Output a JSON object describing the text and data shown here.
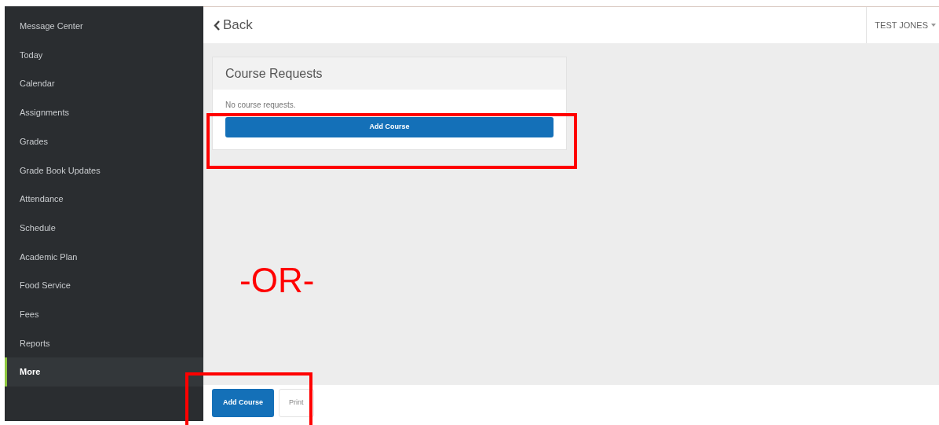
{
  "sidebar": {
    "items": [
      {
        "label": "Message Center",
        "selected": false
      },
      {
        "label": "Today",
        "selected": false
      },
      {
        "label": "Calendar",
        "selected": false
      },
      {
        "label": "Assignments",
        "selected": false
      },
      {
        "label": "Grades",
        "selected": false
      },
      {
        "label": "Grade Book Updates",
        "selected": false
      },
      {
        "label": "Attendance",
        "selected": false
      },
      {
        "label": "Schedule",
        "selected": false
      },
      {
        "label": "Academic Plan",
        "selected": false
      },
      {
        "label": "Food Service",
        "selected": false
      },
      {
        "label": "Fees",
        "selected": false
      },
      {
        "label": "Reports",
        "selected": false
      },
      {
        "label": "More",
        "selected": true
      }
    ]
  },
  "header": {
    "back": "Back",
    "user": "TEST JONES"
  },
  "card": {
    "title": "Course Requests",
    "message": "No course requests.",
    "button": "Add Course"
  },
  "annotation": {
    "text": "-OR-"
  },
  "footer": {
    "buttons": [
      {
        "label": "Add Course",
        "kind": "primary"
      },
      {
        "label": "Print",
        "kind": "secondary"
      }
    ]
  }
}
